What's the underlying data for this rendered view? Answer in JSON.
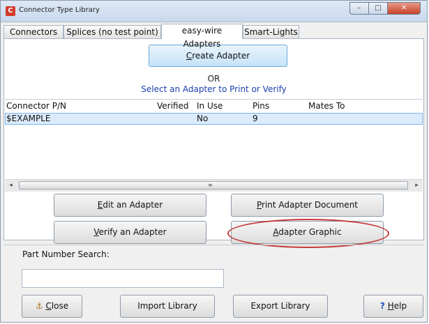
{
  "window": {
    "title": "Connector Type Library",
    "app_icon_letter": "C",
    "controls": {
      "minimize": "–",
      "maximize": "□",
      "close": "✕"
    }
  },
  "tabs": [
    {
      "label": "Connectors",
      "active": false
    },
    {
      "label": "Splices (no test point)",
      "active": false
    },
    {
      "label": "easy-wire Adapters",
      "active": true
    },
    {
      "label": "Smart-Lights",
      "active": false
    }
  ],
  "panel": {
    "create_button": {
      "mnemonic": "C",
      "rest": "reate Adapter"
    },
    "or_text": "OR",
    "select_text": "Select an Adapter to Print or Verify"
  },
  "grid": {
    "columns": [
      "Connector P/N",
      "Verified",
      "In Use",
      "Pins",
      "Mates To"
    ],
    "rows": [
      {
        "connector_pn": "$EXAMPLE",
        "verified": "",
        "in_use": "No",
        "pins": "9",
        "mates_to": ""
      }
    ],
    "scroll_left": "◂",
    "scroll_right": "▸",
    "scroll_grip": "≡"
  },
  "actions": {
    "edit": {
      "mnemonic": "E",
      "rest": "dit an Adapter"
    },
    "print": {
      "mnemonic": "P",
      "rest": "rint Adapter Document"
    },
    "verify": {
      "mnemonic": "V",
      "rest": "erify an Adapter"
    },
    "graphic": {
      "mnemonic": "A",
      "rest": "dapter Graphic"
    }
  },
  "search": {
    "label": "Part Number Search:",
    "value": "",
    "placeholder": ""
  },
  "footer": {
    "close": {
      "icon": "⚓",
      "mnemonic": "C",
      "rest": "lose"
    },
    "import": "Import Library",
    "export": "Export Library",
    "help": {
      "icon": "?",
      "mnemonic": "H",
      "rest": "elp"
    }
  },
  "colors": {
    "annotation_oval": "#c23a3a",
    "accent_blue": "#1a3fb0",
    "selected_row": "#dcebfc"
  }
}
